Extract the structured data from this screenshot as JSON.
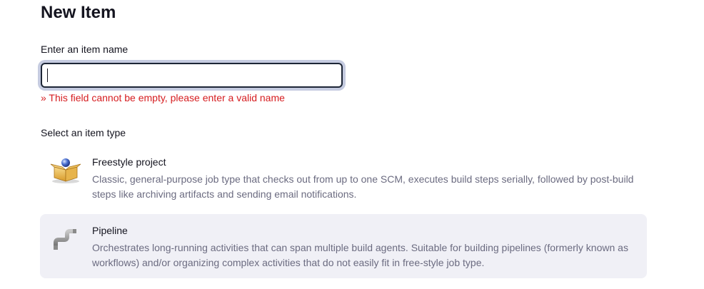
{
  "page": {
    "title": "New Item"
  },
  "form": {
    "name_label": "Enter an item name",
    "name_value": "",
    "error_message": "» This field cannot be empty, please enter a valid name",
    "type_label": "Select an item type"
  },
  "item_types": [
    {
      "name": "Freestyle project",
      "description": "Classic, general-purpose job type that checks out from up to one SCM, executes build steps serially, followed by post-build steps like archiving artifacts and sending email notifications.",
      "icon": "package-icon",
      "selected": false
    },
    {
      "name": "Pipeline",
      "description": "Orchestrates long-running activities that can span multiple build agents. Suitable for building pipelines (formerly known as workflows) and/or organizing complex activities that do not easily fit in free-style job type.",
      "icon": "pipeline-icon",
      "selected": false
    }
  ],
  "colors": {
    "error": "#d61d20",
    "input_border": "#1d2636",
    "focus_ring": "#c5cbe0",
    "hover_background": "#f0f0f6",
    "muted_text": "#6b6b80"
  }
}
